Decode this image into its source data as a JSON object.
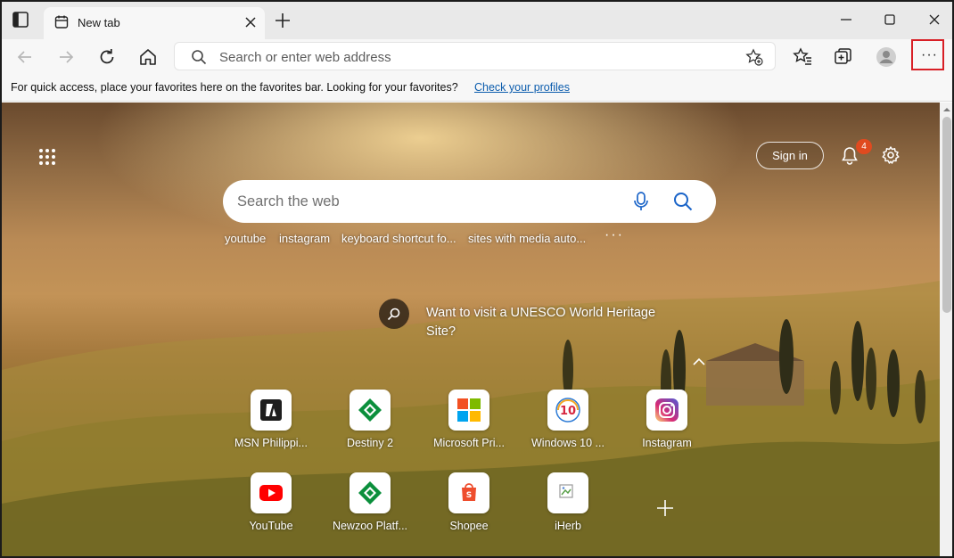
{
  "tab": {
    "title": "New tab"
  },
  "address_bar": {
    "placeholder": "Search or enter web address"
  },
  "favorites_bar": {
    "message": "For quick access, place your favorites here on the favorites bar. Looking for your favorites?",
    "link": "Check your profiles"
  },
  "newtab": {
    "sign_in": "Sign in",
    "notification_count": "4",
    "search_placeholder": "Search the web",
    "suggestions": [
      "youtube",
      "instagram",
      "keyboard shortcut fo...",
      "sites with media auto..."
    ],
    "more_suggestions": "···",
    "hint": "Want to visit a UNESCO World Heritage Site?",
    "tiles_row1": [
      "MSN Philippi...",
      "Destiny 2",
      "Microsoft Pri...",
      "Windows 10 ...",
      "Instagram"
    ],
    "tiles_row2": [
      "YouTube",
      "Newzoo Platf...",
      "Shopee",
      "iHerb"
    ]
  },
  "colors": {
    "accent_highlight": "#d81f26",
    "link": "#0b5cad",
    "badge": "#e04a1f"
  }
}
